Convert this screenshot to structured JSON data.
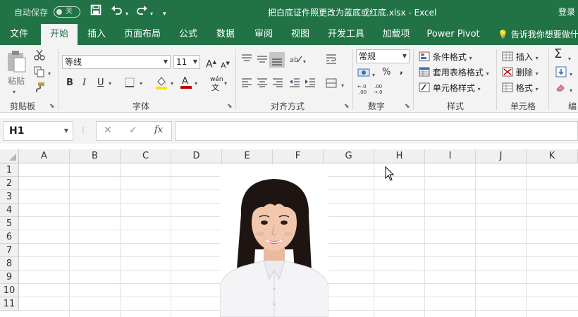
{
  "titlebar": {
    "autosave_label": "自动保存",
    "autosave_state": "关",
    "window_title": "把白底证件照更改为蓝底或红底.xlsx  -  Excel",
    "login": "登录"
  },
  "tabs": [
    {
      "label": "文件"
    },
    {
      "label": "开始"
    },
    {
      "label": "插入"
    },
    {
      "label": "页面布局"
    },
    {
      "label": "公式"
    },
    {
      "label": "数据"
    },
    {
      "label": "审阅"
    },
    {
      "label": "视图"
    },
    {
      "label": "开发工具"
    },
    {
      "label": "加载项"
    },
    {
      "label": "Power Pivot"
    }
  ],
  "tell_me": "告诉我你想要做什么",
  "ribbon": {
    "clipboard": {
      "paste": "粘贴",
      "label": "剪贴板"
    },
    "font": {
      "name": "等线",
      "size": "11",
      "label": "字体",
      "bold": "B",
      "italic": "I",
      "underline": "U",
      "phonetic": "wén"
    },
    "alignment": {
      "label": "对齐方式"
    },
    "number": {
      "format": "常规",
      "label": "数字",
      "percent": "%",
      "comma": ","
    },
    "styles": {
      "conditional": "条件格式",
      "table": "套用表格格式",
      "cell": "单元格样式",
      "label": "样式"
    },
    "cells": {
      "insert": "插入",
      "delete": "删除",
      "format": "格式",
      "label": "单元格"
    },
    "editing": {
      "label": "编"
    }
  },
  "formula_bar": {
    "name_box": "H1",
    "fx": "fx",
    "formula": ""
  },
  "grid": {
    "columns": [
      "A",
      "B",
      "C",
      "D",
      "E",
      "F",
      "G",
      "H",
      "I",
      "J",
      "K"
    ],
    "rows": [
      "1",
      "2",
      "3",
      "4",
      "5",
      "6",
      "7",
      "8",
      "9",
      "10",
      "11"
    ],
    "selected_cell": "H1"
  },
  "colors": {
    "excel_green": "#217346",
    "ribbon_bg": "#f3f3f3"
  }
}
